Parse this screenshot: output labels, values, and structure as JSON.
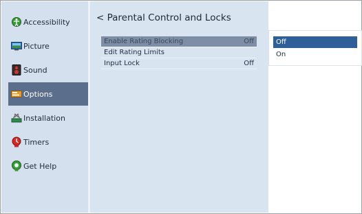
{
  "sidebar": {
    "items": [
      {
        "label": "Accessibility",
        "icon": "accessibility-icon"
      },
      {
        "label": "Picture",
        "icon": "picture-icon"
      },
      {
        "label": "Sound",
        "icon": "sound-icon"
      },
      {
        "label": "Options",
        "icon": "options-icon",
        "selected": true
      },
      {
        "label": "Installation",
        "icon": "installation-icon"
      },
      {
        "label": "Timers",
        "icon": "timers-icon"
      },
      {
        "label": "Get Help",
        "icon": "get-help-icon"
      }
    ]
  },
  "main": {
    "back_glyph": "<",
    "title": "Parental Control and Locks",
    "rows": [
      {
        "label": "Enable Rating Blocking",
        "value": "Off",
        "selected": true
      },
      {
        "label": "Edit Rating Limits",
        "value": ""
      },
      {
        "label": "Input Lock",
        "value": "Off"
      }
    ]
  },
  "popup": {
    "options": [
      {
        "label": "Off",
        "selected": true
      },
      {
        "label": "On"
      }
    ]
  },
  "colors": {
    "sidebar_bg": "#d5e0ee",
    "selected_nav": "#5b6f8d",
    "selected_row": "#7d8ea6",
    "selected_option": "#2f5f99"
  }
}
